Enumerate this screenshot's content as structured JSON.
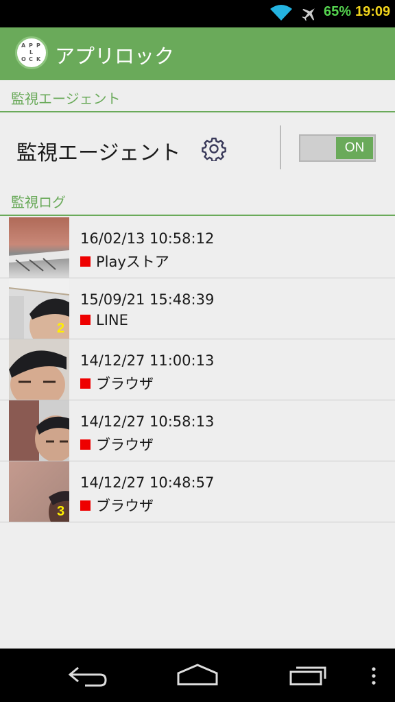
{
  "status_bar": {
    "battery": "65%",
    "time": "19:09",
    "icons": [
      "wifi-icon",
      "airplane-icon"
    ]
  },
  "app_bar": {
    "logo_letters": [
      "A",
      "P",
      "P",
      "L",
      "O",
      "C",
      "K"
    ],
    "title": "アプリロック"
  },
  "agent_section": {
    "header": "監視エージェント",
    "label": "監視エージェント",
    "toggle_label": "ON"
  },
  "log_section": {
    "header": "監視ログ",
    "entries": [
      {
        "time": "16/02/13 10:58:12",
        "app": "Playストア",
        "badge": ""
      },
      {
        "time": "15/09/21 15:48:39",
        "app": "LINE",
        "badge": "2"
      },
      {
        "time": "14/12/27 11:00:13",
        "app": "ブラウザ",
        "badge": ""
      },
      {
        "time": "14/12/27 10:58:13",
        "app": "ブラウザ",
        "badge": ""
      },
      {
        "time": "14/12/27 10:48:57",
        "app": "ブラウザ",
        "badge": "3"
      }
    ]
  },
  "colors": {
    "accent": "#6aaa5a",
    "status_marker": "#ee0000",
    "badge": "#ffee00"
  }
}
